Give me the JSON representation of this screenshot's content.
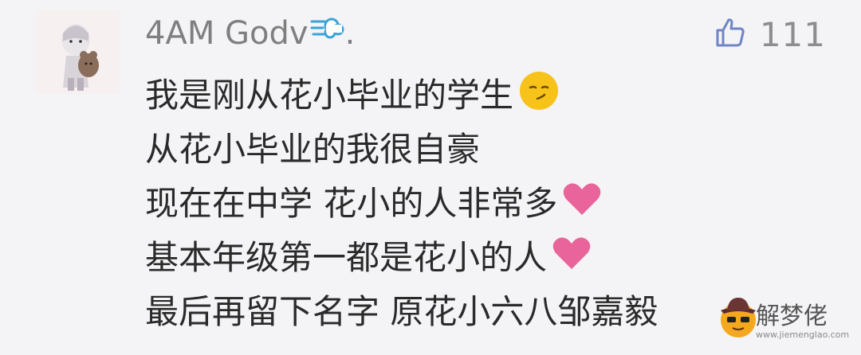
{
  "comment": {
    "username": "4AM Godv",
    "username_suffix": ".",
    "like_count": "111",
    "lines": [
      "我是刚从花小毕业的学生",
      "从花小毕业的我很自豪",
      "现在在中学 花小的人非常多",
      "基本年级第一都是花小的人",
      "最后再留下名字 原花小六八邹嘉毅"
    ]
  },
  "watermark": {
    "name": "解梦佬",
    "url": "www.jiemenglao.com"
  },
  "icons": {
    "name_emoji": "dash-cloud-icon",
    "like": "thumbs-up-icon",
    "line1_emoji": "smirk-face-icon",
    "heart": "pink-heart-icon"
  },
  "colors": {
    "background": "#f4f3f6",
    "username": "#7f7f80",
    "text": "#2a2a2a",
    "heart": "#e8649a",
    "emoji": "#f7c21a",
    "like": "#6f86c6"
  }
}
